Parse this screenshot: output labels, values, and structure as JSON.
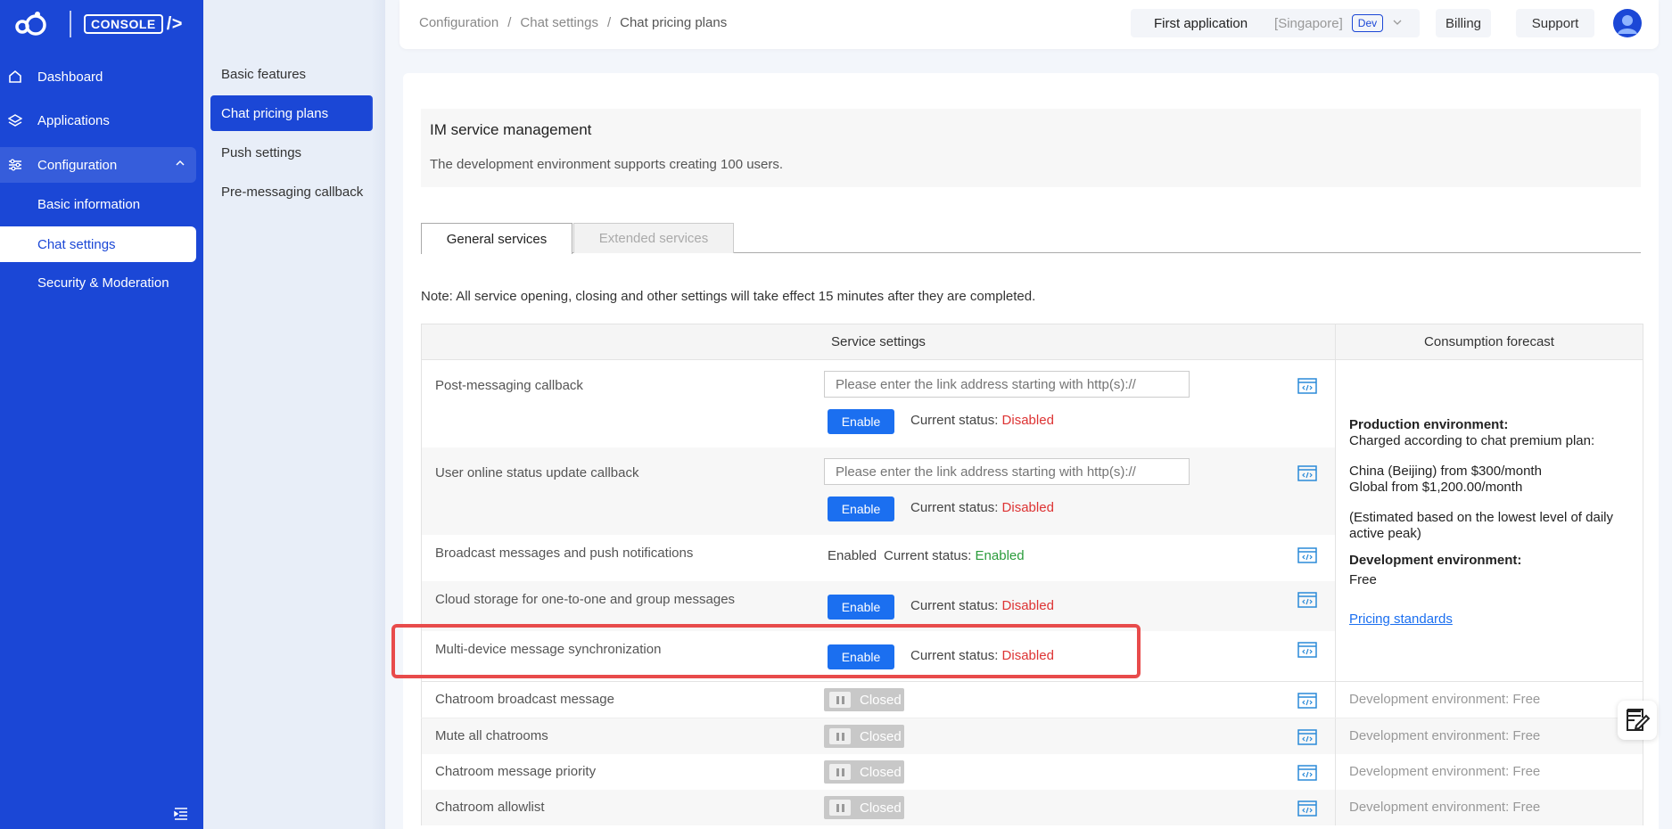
{
  "logo": {
    "console_label": "CONSOLE",
    "slash_label": "/>"
  },
  "leftnav": {
    "dashboard": "Dashboard",
    "applications": "Applications",
    "configuration": "Configuration",
    "sub": [
      "Basic information",
      "Chat settings",
      "Security & Moderation"
    ]
  },
  "subnav": [
    "Basic features",
    "Chat pricing plans",
    "Push settings",
    "Pre-messaging callback"
  ],
  "header": {
    "crumbs": [
      "Configuration",
      "/",
      "Chat settings",
      "/",
      "Chat pricing plans"
    ],
    "app_name": "First application",
    "region": "[Singapore]",
    "env_badge": "Dev",
    "billing": "Billing",
    "support": "Support"
  },
  "im": {
    "title": "IM service management",
    "desc": "The development environment supports creating 100 users."
  },
  "tabs": {
    "general": "General services",
    "extended": "Extended services"
  },
  "note": "Note: All service opening, closing and other settings will take effect 15 minutes after they are completed.",
  "table": {
    "col_service": "Service settings",
    "col_forecast": "Consumption forecast",
    "url_placeholder": "Please enter the link address starting with http(s)://",
    "enable_label": "Enable",
    "status_prefix": "Current status:",
    "disabled": "Disabled",
    "enabled": "Enabled",
    "enabled_text": "Enabled",
    "closed": "Closed",
    "dev_free": "Development environment: Free",
    "rows": [
      "Post-messaging callback",
      "User online status update callback",
      "Broadcast messages and push notifications",
      "Cloud storage for one-to-one and group messages",
      "Multi-device message synchronization",
      "Chatroom broadcast message",
      "Mute all chatrooms",
      "Chatroom message priority",
      "Chatroom allowlist"
    ]
  },
  "forecast": {
    "prod_title": "Production environment:",
    "prod_line": "Charged according to chat premium plan:",
    "china": "China (Beijing) from $300/month",
    "global": "Global from $1,200.00/month",
    "estimate": "(Estimated based on the lowest level of daily active peak)",
    "dev_title": "Development environment:",
    "dev_free": "Free",
    "link": "Pricing standards"
  },
  "colors": {
    "brand": "#1b47d6",
    "enable_button": "#1b6ff0",
    "disabled": "#d33333",
    "enabled": "#2a9c3b",
    "highlight": "#e84b4b"
  }
}
